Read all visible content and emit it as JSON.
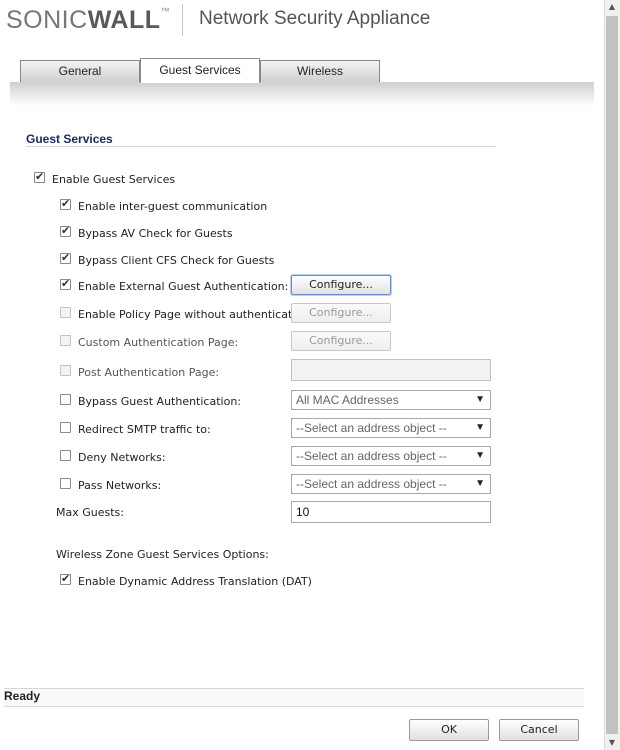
{
  "header": {
    "logo_sonic": "SONIC",
    "logo_wall": "WALL",
    "logo_tm": "™",
    "title": "Network Security Appliance"
  },
  "tabs": [
    {
      "label": "General"
    },
    {
      "label": "Guest Services",
      "active": true
    },
    {
      "label": "Wireless"
    }
  ],
  "section": {
    "title": "Guest Services"
  },
  "options": {
    "enable_guest_services": {
      "label": "Enable Guest Services",
      "checked": true
    },
    "inter_guest": {
      "label": "Enable inter-guest communication",
      "checked": true
    },
    "bypass_av": {
      "label": "Bypass AV Check for Guests",
      "checked": true
    },
    "bypass_cfs": {
      "label": "Bypass Client CFS Check for Guests",
      "checked": true
    },
    "external_auth": {
      "label": "Enable External Guest Authentication:",
      "checked": true,
      "button": "Configure..."
    },
    "policy_page": {
      "label": "Enable Policy Page without authentication:",
      "checked": false,
      "button": "Configure..."
    },
    "custom_auth": {
      "label": "Custom Authentication Page:",
      "checked": false,
      "button": "Configure..."
    },
    "post_auth": {
      "label": "Post Authentication Page:",
      "checked": false,
      "value": ""
    },
    "bypass_guest_auth": {
      "label": "Bypass Guest Authentication:",
      "checked": false,
      "select": "All MAC Addresses"
    },
    "redirect_smtp": {
      "label": "Redirect SMTP traffic to:",
      "checked": false,
      "select": "--Select an address object --"
    },
    "deny_networks": {
      "label": "Deny Networks:",
      "checked": false,
      "select": "--Select an address object --"
    },
    "pass_networks": {
      "label": "Pass Networks:",
      "checked": false,
      "select": "--Select an address object --"
    },
    "max_guests": {
      "label": "Max Guests:",
      "value": "10"
    }
  },
  "wireless": {
    "heading": "Wireless Zone Guest Services Options:",
    "dat": {
      "label": "Enable Dynamic Address Translation (DAT)",
      "checked": true
    }
  },
  "status": {
    "text": "Ready"
  },
  "footer": {
    "ok": "OK",
    "cancel": "Cancel"
  },
  "icons": {
    "checkmark": "✔",
    "dropdown": "▼",
    "scroll_up": "▲",
    "scroll_down": "▼"
  },
  "colors": {
    "brand_accent": "#e8491d",
    "section_title": "#1a2a5a"
  }
}
